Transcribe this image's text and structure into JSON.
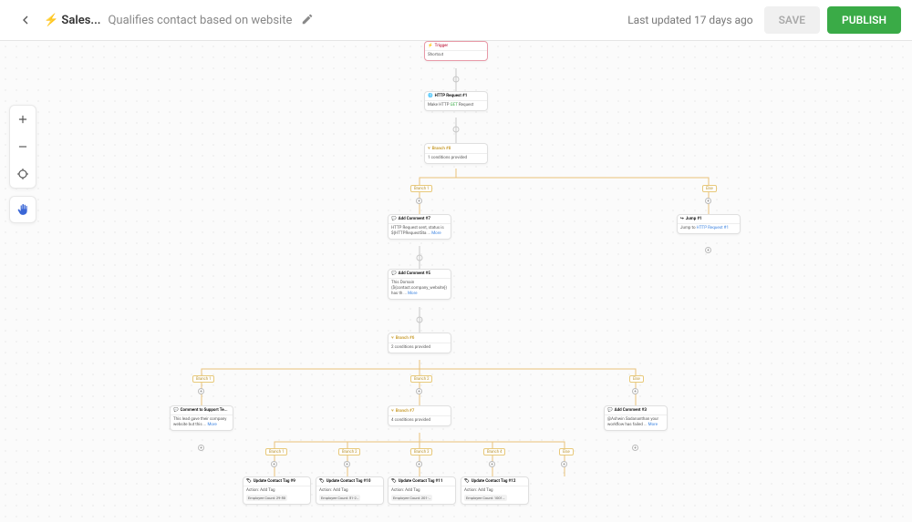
{
  "header": {
    "title": "⚡ Sales...",
    "subtitle": "Qualifies contact based on website",
    "updated": "Last updated 17 days ago",
    "save": "SAVE",
    "publish": "PUBLISH"
  },
  "nodes": {
    "trigger": {
      "title": "Trigger",
      "body": "Shortcut"
    },
    "http1": {
      "title": "HTTP Request #1",
      "body_pre": "Make HTTP ",
      "verb": "GET",
      "body_post": " Request"
    },
    "branch8": {
      "title": "Branch #8",
      "body": "1 conditions provided"
    },
    "jump1": {
      "title": "Jump #1",
      "body_pre": "Jump to ",
      "link": "HTTP Request #1"
    },
    "comment7": {
      "title": "Add Comment #7",
      "body": "HTTP Request sent, status  is ${HTTPRequestSta ... ",
      "more": "More"
    },
    "comment5": {
      "title": "Add Comment #5",
      "body": "This Domain (${contact.company_website}) has th ... ",
      "more": "More"
    },
    "branch6": {
      "title": "Branch #6",
      "body": "2 conditions provided"
    },
    "commentSupport": {
      "title": "Comment to Support Te...",
      "body": "This lead gave their company website but this ... ",
      "more": "More"
    },
    "branch7": {
      "title": "Branch #7",
      "body": "4 conditions provided"
    },
    "comment3": {
      "title": "Add Comment #3",
      "body": "@Ashwin Sadananthan your workflow has failed ... ",
      "more": "More"
    },
    "tag9": {
      "title": "Update Contact Tag #9",
      "action": "Action: Add Tag",
      "tag": "Employee Count: 29-50"
    },
    "tag10": {
      "title": "Update Contact Tag #10",
      "action": "Action: Add Tag",
      "tag": "Employee Count: 51-2…"
    },
    "tag11": {
      "title": "Update Contact Tag #11",
      "action": "Action: Add Tag",
      "tag": "Employee Count: 201-…"
    },
    "tag12": {
      "title": "Update Contact Tag #12",
      "action": "Action: Add Tag",
      "tag": "Employee Count: 1001…"
    }
  },
  "badges": {
    "b1": "Branch 1",
    "else1": "Else",
    "bb1": "Branch 1",
    "bb2": "Branch 2",
    "else2": "Else",
    "c1": "Branch 1",
    "c2": "Branch 2",
    "c3": "Branch 3",
    "c4": "Branch 4",
    "celse": "Else"
  }
}
